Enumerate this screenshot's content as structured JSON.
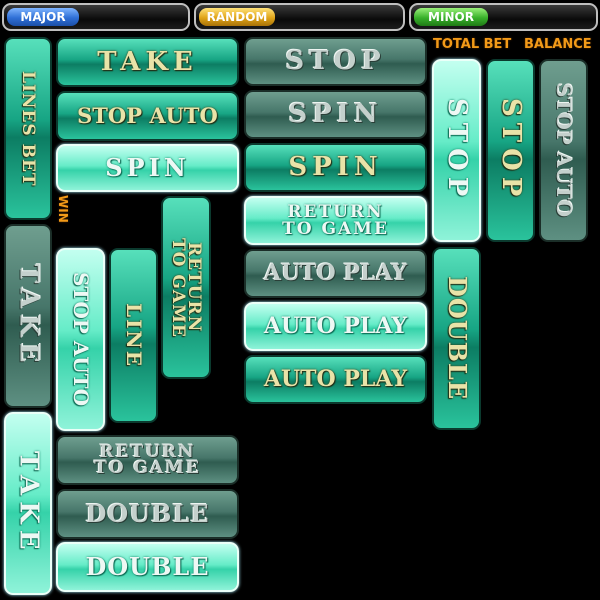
{
  "jackpots": {
    "major": {
      "label": "MAJOR",
      "color": "#2f6fd6"
    },
    "random": {
      "label": "RANDOM",
      "color": "#e0a418"
    },
    "minor": {
      "label": "MINOR",
      "color": "#38b02a"
    }
  },
  "labels": {
    "total_bet": "TOTAL BET",
    "balance": "BALANCE",
    "win": "WIN"
  },
  "buttons": {
    "lines_bet_vertical": "LINES BET",
    "take_top": "TAKE",
    "stop_auto_1": "STOP AUTO",
    "spin_light_left": "SPIN",
    "return_vertical": [
      "RETURN",
      "TO GAME"
    ],
    "take_dark_vertical": "TAKE",
    "stop_auto_vertical_light": "STOP AUTO",
    "line_vertical": "LINE",
    "take_light_vertical": "TAKE",
    "return_dark": [
      "RETURN",
      "TO GAME"
    ],
    "double_dark": "DOUBLE",
    "double_light": "DOUBLE",
    "stop_dark": "STOP",
    "spin_dark": "SPIN",
    "spin_med": "SPIN",
    "return_light": [
      "RETURN",
      "TO GAME"
    ],
    "auto_play_dark": "AUTO PLAY",
    "auto_play_light": "AUTO PLAY",
    "auto_play_med": "AUTO PLAY",
    "stop_light_vertical": "STOP",
    "stop_med_vertical": "STOP",
    "stop_auto_dark_vertical": "STOP AUTO",
    "double_med_vertical": "DOUBLE"
  }
}
